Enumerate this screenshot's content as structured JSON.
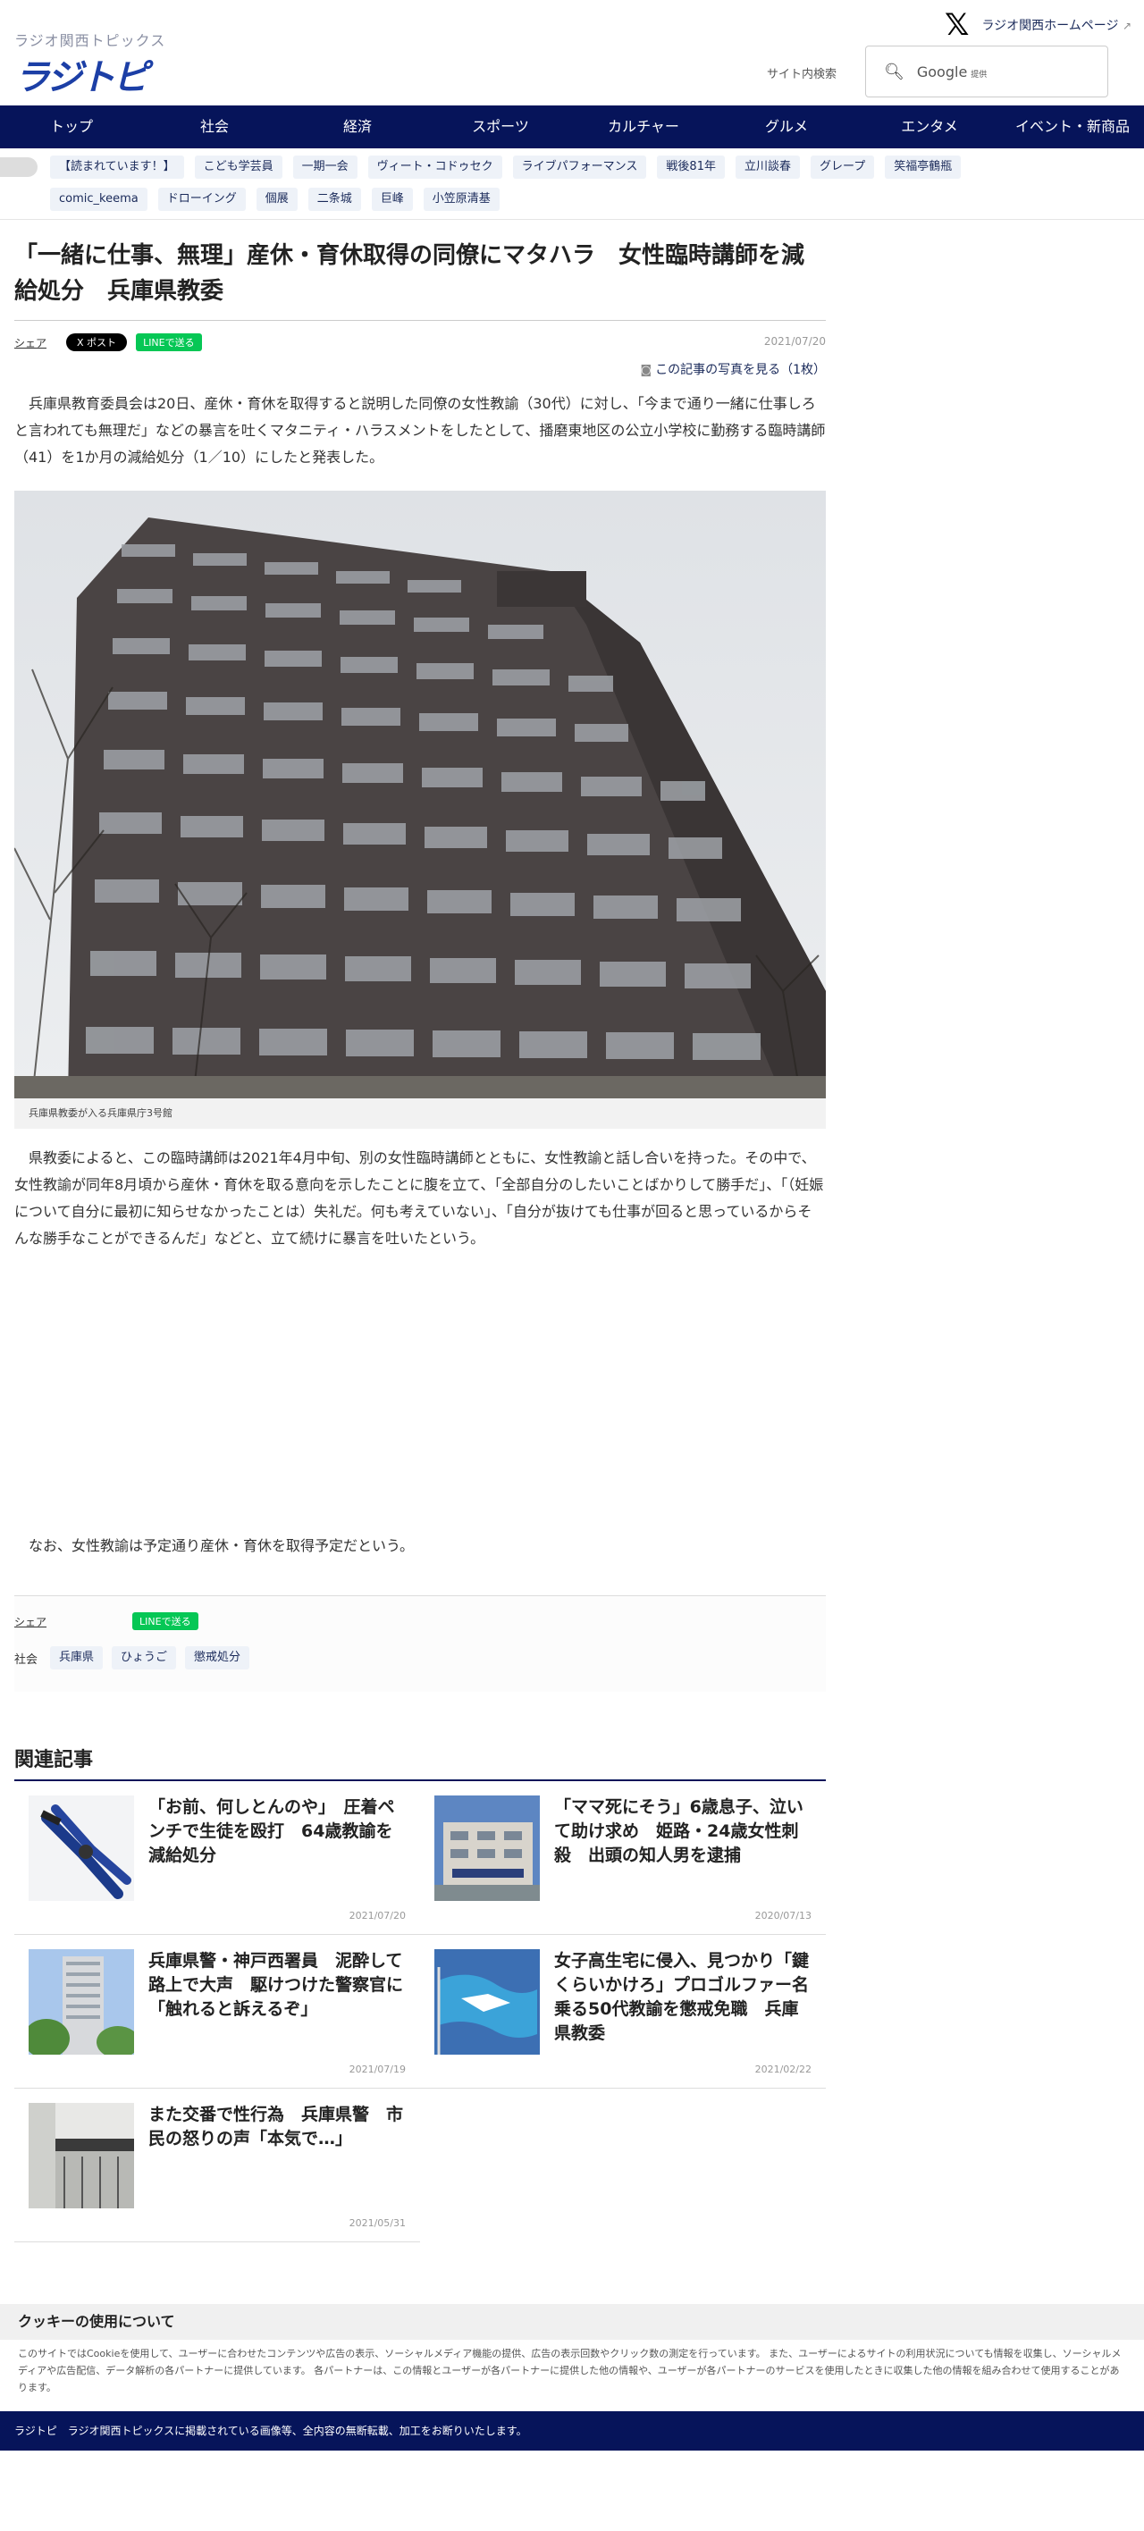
{
  "header": {
    "logo_sub": "ラジオ関西トピックス",
    "logo_main": "ラジトピ",
    "x_icon": "x-logo-icon",
    "home_link": "ラジオ関西ホームページ",
    "search_label": "サイト内検索",
    "search_google": "Google",
    "search_provided": "提供"
  },
  "nav": {
    "items": [
      "トップ",
      "社会",
      "経済",
      "スポーツ",
      "カルチャー",
      "グルメ",
      "エンタメ",
      "イベント・新商品"
    ]
  },
  "tags": [
    "【読まれています！】",
    "こども学芸員",
    "一期一会",
    "ヴィート・コドゥセク",
    "ライブパフォーマンス",
    "戦後81年",
    "立川談春",
    "グレープ",
    "笑福亭鶴瓶",
    "comic_keema",
    "ドローイング",
    "個展",
    "二条城",
    "巨峰",
    "小笠原清基"
  ],
  "article": {
    "headline": "「一緒に仕事、無理」産休・育休取得の同僚にマタハラ　女性臨時講師を減給処分　兵庫県教委",
    "share_label": "シェア",
    "x_post": "X ポスト",
    "line_send": "LINEで送る",
    "date": "2021/07/20",
    "photo_link": "この記事の写真を見る（1枚）",
    "para1": "　兵庫県教育委員会は20日、産休・育休を取得すると説明した同僚の女性教諭（30代）に対し、「今まで通り一緒に仕事しろと言われても無理だ」などの暴言を吐くマタニティ・ハラスメントをしたとして、播磨東地区の公立小学校に勤務する臨時講師（41）を1か月の減給処分（1／10）にしたと発表した。",
    "caption": "兵庫県教委が入る兵庫県庁3号館",
    "para2": "　県教委によると、この臨時講師は2021年4月中旬、別の女性臨時講師とともに、女性教諭と話し合いを持った。その中で、女性教諭が同年8月頃から産休・育休を取る意向を示したことに腹を立て、「全部自分のしたいことばかりして勝手だ」、「（妊娠について自分に最初に知らせなかったことは）失礼だ。何も考えていない」、「自分が抜けても仕事が回ると思っているからそんな勝手なことができるんだ」などと、立て続けに暴言を吐いたという。",
    "para3": "　なお、女性教諭は予定通り産休・育休を取得予定だという。",
    "category": "社会",
    "footer_tags": [
      "兵庫県",
      "ひょうご",
      "懲戒処分"
    ]
  },
  "related": {
    "title": "関連記事",
    "items": [
      {
        "title": "「お前、何しとんのや」　圧着ペンチで生徒を殴打　64歳教諭を減給処分",
        "date": "2021/07/20",
        "thumb": "pliers-photo"
      },
      {
        "title": "「ママ死にそう」6歳息子、泣いて助け求め　姫路・24歳女性刺殺　出頭の知人男を逮捕",
        "date": "2020/07/13",
        "thumb": "police-building-photo"
      },
      {
        "title": "兵庫県警・神戸西署員　泥酔して路上で大声　駆けつけた警察官に「触れると訴えるぞ」",
        "date": "2021/07/19",
        "thumb": "tower-building-photo"
      },
      {
        "title": "女子高生宅に侵入、見つかり「鍵くらいかけろ」プロゴルファー名乗る50代教諭を懲戒免職　兵庫県教委",
        "date": "2021/02/22",
        "thumb": "flag-photo"
      },
      {
        "title": "また交番で性行為　兵庫県警　市民の怒りの声「本気で…」",
        "date": "2021/05/31",
        "thumb": "police-box-photo"
      }
    ]
  },
  "cookie": {
    "title": "クッキーの使用について",
    "text": "このサイトではCookieを使用して、ユーザーに合わせたコンテンツや広告の表示、ソーシャルメディア機能の提供、広告の表示回数やクリック数の測定を行っています。 また、ユーザーによるサイトの利用状況についても情報を収集し、ソーシャルメディアや広告配信、データ解析の各パートナーに提供しています。 各パートナーは、この情報とユーザーが各パートナーに提供した他の情報や、ユーザーが各パートナーのサービスを使用したときに収集した他の情報を組み合わせて使用することがあります。"
  },
  "copyright": "ラジトピ　ラジオ関西トピックスに掲載されている画像等、全内容の無断転載、加工をお断りいたします。",
  "colors": {
    "navy": "#06145a",
    "line_green": "#06c755",
    "tag_bg": "#eef2f8"
  }
}
